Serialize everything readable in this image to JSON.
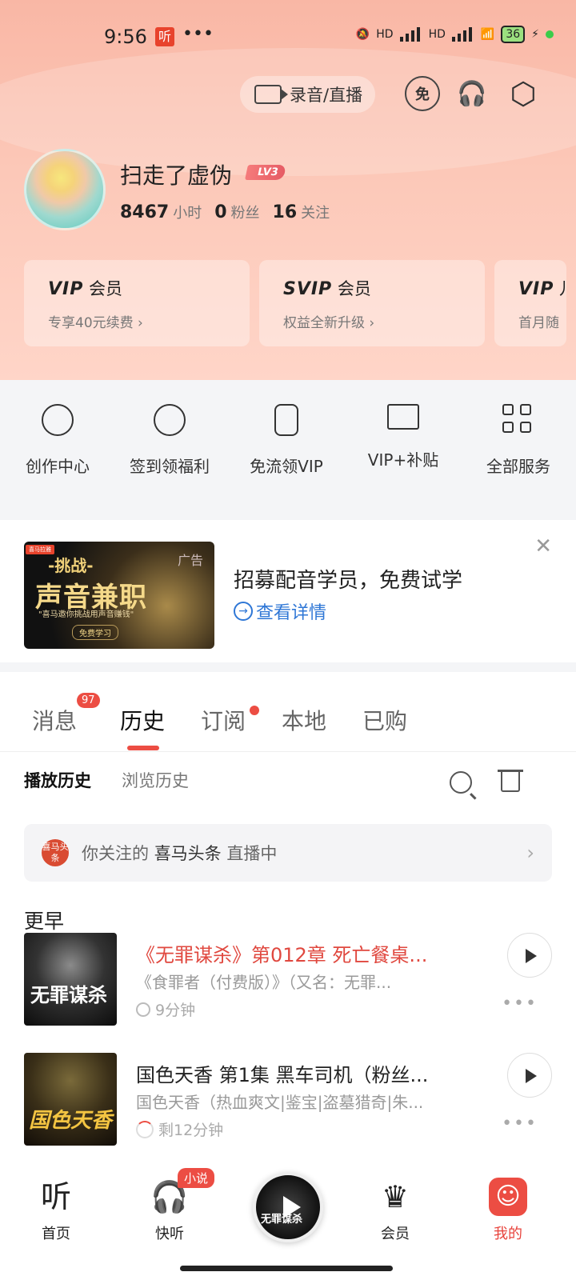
{
  "status_bar": {
    "time": "9:56",
    "app_badge": "听",
    "dots": "•••",
    "battery": "36",
    "hd1": "HD",
    "hd2": "HD"
  },
  "header": {
    "record_label": "录音/直播",
    "free_icon_text": "免",
    "user": {
      "name": "扫走了虚伪",
      "level": "LV3"
    },
    "stats": [
      {
        "num": "8467",
        "unit": "小时"
      },
      {
        "num": "0",
        "unit": "粉丝"
      },
      {
        "num": "16",
        "unit": "关注"
      }
    ],
    "vip_cards": [
      {
        "brand": "VIP",
        "title": "会员",
        "subtitle": "专享40元续费 ›"
      },
      {
        "brand": "SVIP",
        "title": "会员",
        "subtitle": "权益全新升级 ›"
      },
      {
        "brand": "VIP",
        "title": "儿",
        "subtitle": "首月随"
      }
    ]
  },
  "services": [
    {
      "label": "创作中心",
      "icon": "creator-icon"
    },
    {
      "label": "签到领福利",
      "icon": "checkin-icon"
    },
    {
      "label": "免流领VIP",
      "icon": "simcard-icon"
    },
    {
      "label": "VIP+补贴",
      "icon": "coupon-icon"
    },
    {
      "label": "全部服务",
      "icon": "grid-icon"
    }
  ],
  "ad": {
    "image": {
      "brand": "喜马拉雅",
      "line1": "-挑战-",
      "line2": "声音兼职",
      "line3": "\"喜马邀你挑战用声音赚钱\"",
      "line4": "免费学习",
      "tag": "广告"
    },
    "title": "招募配音学员，免费试学",
    "link": "查看详情"
  },
  "tabs": {
    "items": [
      "消息",
      "历史",
      "订阅",
      "本地",
      "已购"
    ],
    "active": "历史",
    "message_badge": "97"
  },
  "subtabs": {
    "play_history": "播放历史",
    "browse_history": "浏览历史"
  },
  "live_bar": {
    "logo": "喜马头条",
    "prefix": "你关注的",
    "name": "喜马头条",
    "suffix": "直播中",
    "chevron": "›"
  },
  "section_label": "更早",
  "history": [
    {
      "cover_text": "无罪谋杀",
      "title": "《无罪谋杀》第012章 死亡餐桌...",
      "subtitle": "《食罪者（付费版）》（又名：无罪...",
      "duration": "9分钟"
    },
    {
      "cover_text": "国色天香",
      "title": "国色天香 第1集 黑车司机（粉丝...",
      "subtitle": "国色天香（热血爽文|鉴宝|盗墓猎奇|朱...",
      "duration": "剩12分钟"
    }
  ],
  "bottom_nav": {
    "items": [
      {
        "label": "首页",
        "icon": "听"
      },
      {
        "label": "快听",
        "icon": "🎧"
      },
      {
        "label": "会员",
        "icon": "♛"
      },
      {
        "label": "我的",
        "icon": "☺"
      }
    ],
    "novel_badge": "小说",
    "now_playing": "无罪谋杀",
    "active": "我的"
  },
  "colors": {
    "accent": "#ec4d43",
    "link": "#2f77d6",
    "header_bg": "#fcc8b8"
  }
}
